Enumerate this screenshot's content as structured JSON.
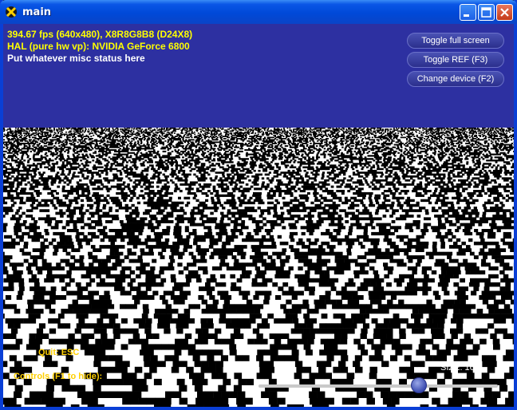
{
  "window": {
    "title": "main",
    "icons": {
      "app": "directx-x-icon",
      "minimize": "minimize-icon",
      "maximize": "maximize-icon",
      "close": "close-icon"
    }
  },
  "stats": {
    "line1": "394.67 fps (640x480), X8R8G8B8 (D24X8)",
    "line2": "HAL (pure hw vp): NVIDIA GeForce 6800",
    "line3": "Put whatever misc status here"
  },
  "hud_buttons": {
    "toggle_full_screen": "Toggle full screen",
    "toggle_ref": "Toggle REF (F3)",
    "change_device": "Change device (F2)"
  },
  "overlay": {
    "quit_label": "Quit: ESC",
    "controls_label": "Controls (F1 to hide):",
    "size_label": "SIZE: 169",
    "size_slider_fraction": 0.67
  },
  "colors": {
    "sky": "#2d30a1",
    "stats_yellow": "#ffff00",
    "overlay_yellow": "#ffd000",
    "titlebar": "#0049d8"
  }
}
